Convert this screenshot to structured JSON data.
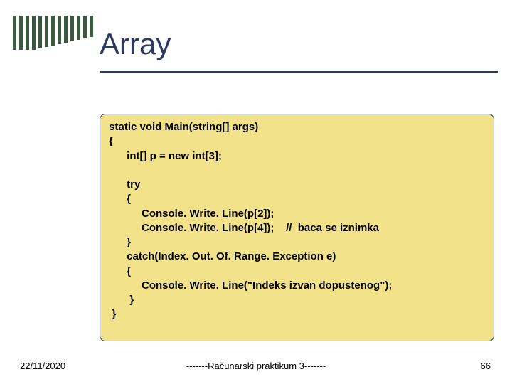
{
  "title": "Array",
  "code": {
    "l1": " static void Main(string[] args)",
    "l2": " {",
    "l3": "       int[] p = new int[3];",
    "l4": "",
    "l5": "       try",
    "l6": "       {",
    "l7": "            Console. Write. Line(p[2]);",
    "l8a": "            Console. Write. Line(p[4]);",
    "l8b": "    //  baca se iznimka",
    "l9": "       }",
    "l10": "       catch(Index. Out. Of. Range. Exception e)",
    "l11": "       {",
    "l12": "            Console. Write. Line(\"Indeks izvan dopustenog\");",
    "l13": "        }",
    "l14": "  }"
  },
  "footer": {
    "date": "22/11/2020",
    "center": "-------Računarski praktikum 3-------",
    "page": "66"
  },
  "stripe_heights": [
    48,
    48,
    48,
    48,
    46,
    44,
    42,
    40,
    38,
    36,
    34,
    32,
    30
  ]
}
